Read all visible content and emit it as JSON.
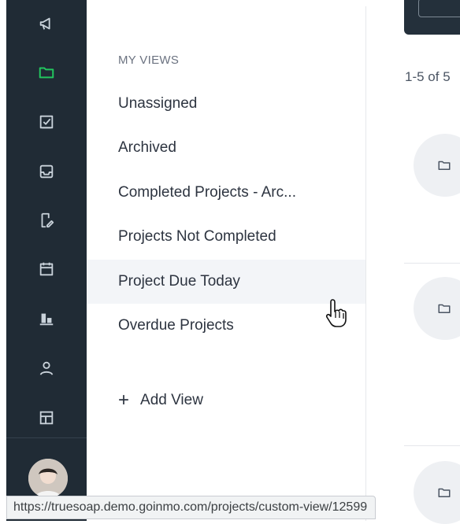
{
  "rail": {
    "icons": [
      {
        "name": "megaphone-icon",
        "active": false
      },
      {
        "name": "folder-icon",
        "active": true
      },
      {
        "name": "checkbox-icon",
        "active": false
      },
      {
        "name": "inbox-icon",
        "active": false
      },
      {
        "name": "document-edit-icon",
        "active": false
      },
      {
        "name": "calendar-icon",
        "active": false
      },
      {
        "name": "bar-chart-icon",
        "active": false
      },
      {
        "name": "user-icon",
        "active": false
      },
      {
        "name": "layout-icon",
        "active": false
      }
    ],
    "active_color": "#22c55e"
  },
  "views": {
    "heading": "MY VIEWS",
    "items": [
      {
        "label": "Unassigned"
      },
      {
        "label": "Archived"
      },
      {
        "label": "Completed Projects - Arc..."
      },
      {
        "label": "Projects Not Completed"
      },
      {
        "label": "Project Due Today"
      },
      {
        "label": "Overdue Projects"
      }
    ],
    "add_view_label": "Add View"
  },
  "main": {
    "pager_text": "1-5 of 5"
  },
  "statusbar": {
    "url": "https://truesoap.demo.goinmo.com/projects/custom-view/12599"
  }
}
